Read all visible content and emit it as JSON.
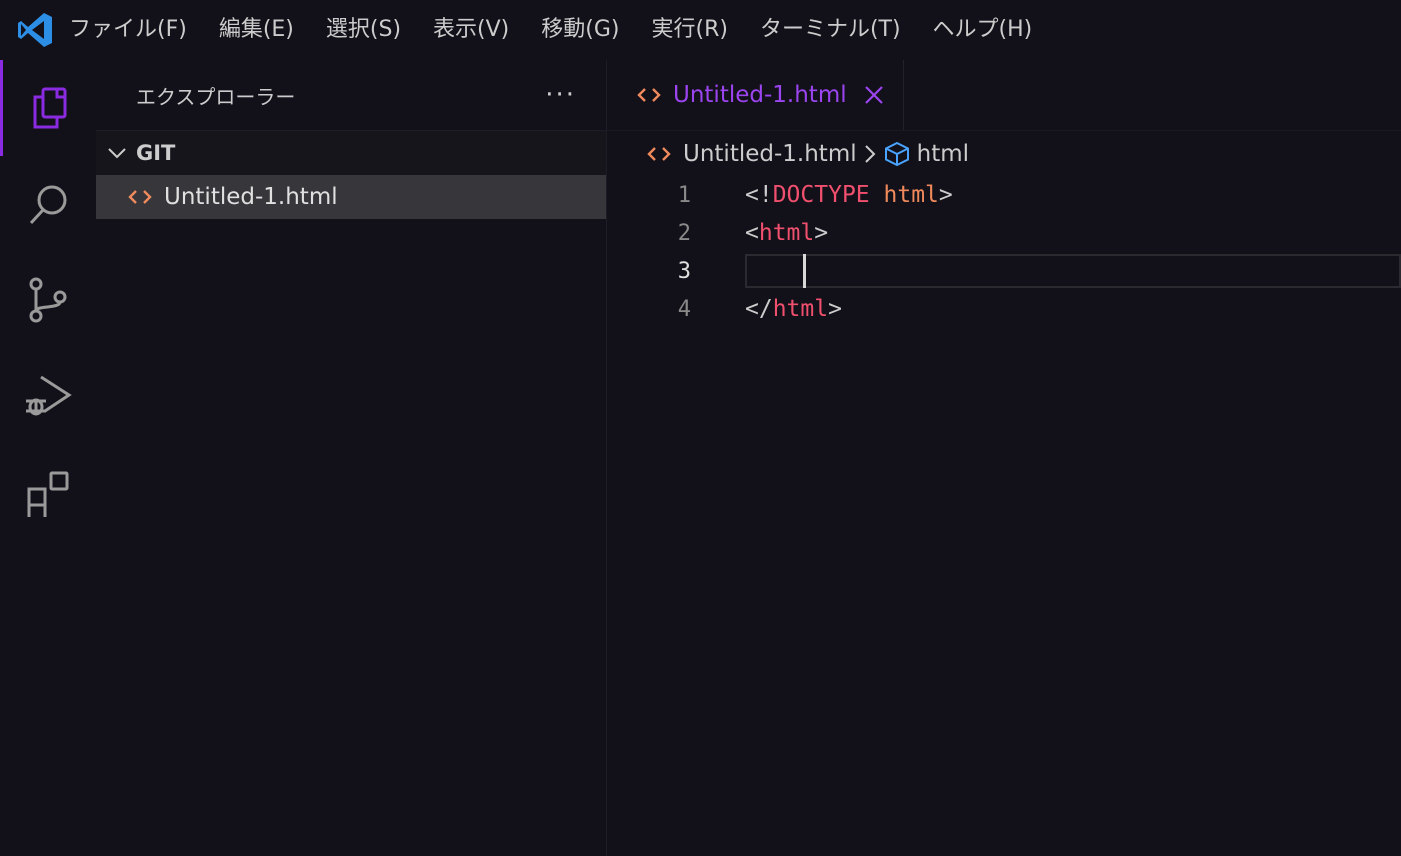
{
  "menu": {
    "items": [
      "ファイル(F)",
      "編集(E)",
      "選択(S)",
      "表示(V)",
      "移動(G)",
      "実行(R)",
      "ターミナル(T)",
      "ヘルプ(H)"
    ]
  },
  "sidebar": {
    "title": "エクスプローラー",
    "more": "···",
    "section": "GIT",
    "files": [
      {
        "name": "Untitled-1.html"
      }
    ]
  },
  "editor": {
    "tab_label": "Untitled-1.html",
    "breadcrumb": {
      "file": "Untitled-1.html",
      "symbol": "html"
    },
    "line_numbers": [
      "1",
      "2",
      "3",
      "4"
    ],
    "code": {
      "l1": {
        "open": "<!",
        "doctype": "DOCTYPE",
        "space": " ",
        "html": "html",
        "close": ">"
      },
      "l2": {
        "open": "<",
        "tag": "html",
        "close": ">"
      },
      "l4": {
        "open": "</",
        "tag": "html",
        "close": ">"
      }
    }
  },
  "colors": {
    "accent": "#8a2be2",
    "tab_text": "#9b45f0",
    "html_icon": "#f08a5d",
    "tag_red": "#f0506e"
  }
}
